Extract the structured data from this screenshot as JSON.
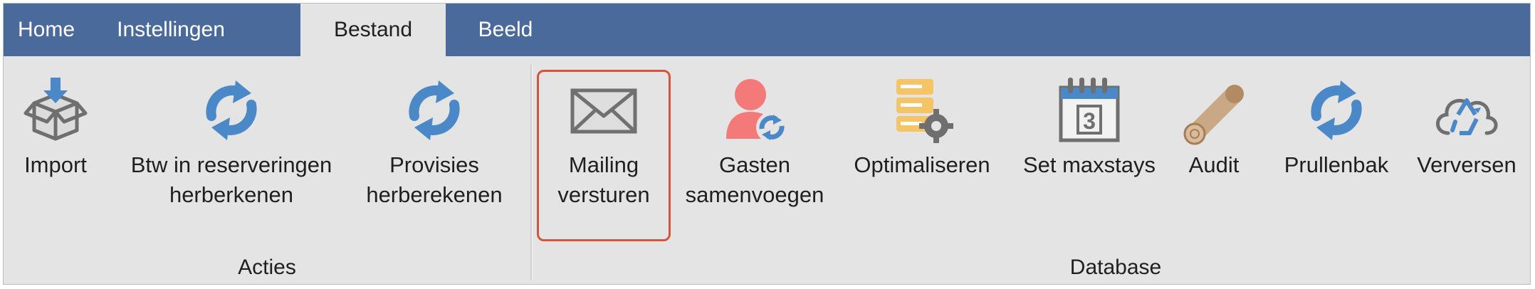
{
  "tabs": [
    "Home",
    "Instellingen",
    "Bestand",
    "Beeld"
  ],
  "active_tab": "Bestand",
  "groups": {
    "acties": {
      "label": "Acties",
      "items": [
        {
          "label_lines": [
            "Import"
          ],
          "icon": "box-import-icon"
        },
        {
          "label_lines": [
            "Btw in reserveringen",
            "herberkenen"
          ],
          "icon": "refresh-icon"
        },
        {
          "label_lines": [
            "Provisies",
            "herberekenen"
          ],
          "icon": "refresh-icon"
        }
      ]
    },
    "database": {
      "label": "Database",
      "items": [
        {
          "label_lines": [
            "Mailing",
            "versturen"
          ],
          "icon": "envelope-icon",
          "highlighted": true
        },
        {
          "label_lines": [
            "Gasten",
            "samenvoegen"
          ],
          "icon": "user-merge-icon"
        },
        {
          "label_lines": [
            "Optimaliseren"
          ],
          "icon": "database-gear-icon"
        },
        {
          "label_lines": [
            "Set maxstays"
          ],
          "icon": "calendar-icon",
          "calendar_day": "3"
        },
        {
          "label_lines": [
            "Audit"
          ],
          "icon": "log-icon"
        },
        {
          "label_lines": [
            "Prullenbak"
          ],
          "icon": "refresh-icon"
        },
        {
          "label_lines": [
            "Verversen"
          ],
          "icon": "cloud-recycle-icon"
        }
      ]
    }
  },
  "colors": {
    "tabbar": "#4a6a9b",
    "ribbon": "#e4e4e4",
    "refresh_blue": "#4a88c7",
    "highlight_border": "#d4553d",
    "user_red": "#f47a7a",
    "db_orange": "#f5c465"
  }
}
